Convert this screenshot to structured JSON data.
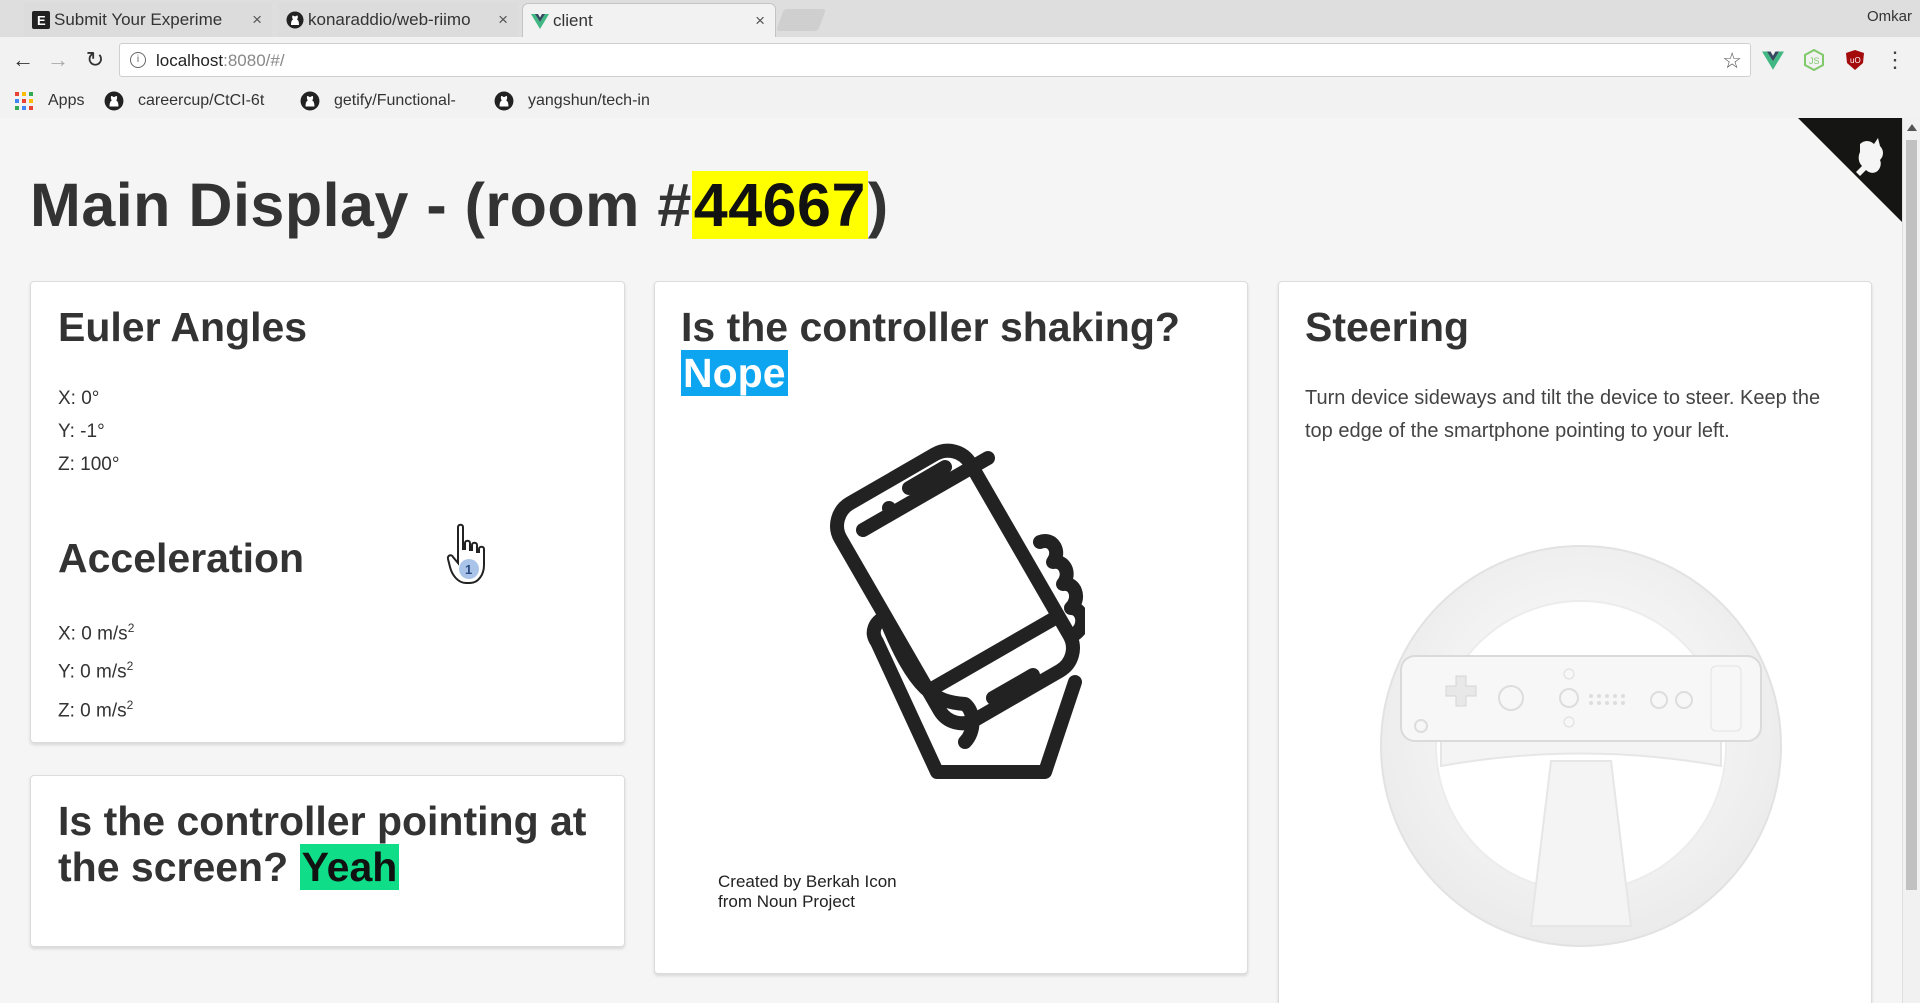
{
  "browser": {
    "tabs": [
      {
        "title": "Submit Your Experime",
        "favicon": "E",
        "active": false
      },
      {
        "title": "konaraddio/web-riimo",
        "favicon": "github-icon",
        "active": false
      },
      {
        "title": "client",
        "favicon": "vue-icon",
        "active": true
      }
    ],
    "profile": "Omkar",
    "url_host": "localhost",
    "url_path": ":8080/#/",
    "bookmarks": [
      {
        "label": "Apps",
        "icon": "apps-grid-icon"
      },
      {
        "label": "careercup/CtCI-6t",
        "icon": "github-icon"
      },
      {
        "label": "getify/Functional-",
        "icon": "github-icon"
      },
      {
        "label": "yangshun/tech-in",
        "icon": "github-icon"
      }
    ],
    "tab_close": "×"
  },
  "page": {
    "title_prefix": "Main Display - (room #",
    "room_number": "44667",
    "title_suffix": ")"
  },
  "euler": {
    "title": "Euler Angles",
    "x": "X: 0°",
    "y": "Y: -1°",
    "z": "Z: 100°"
  },
  "acceleration": {
    "title": "Acceleration",
    "x": "X: 0 m/s",
    "y": "Y: 0 m/s",
    "z": "Z: 0 m/s",
    "exponent": "2"
  },
  "pointing": {
    "question": "Is the controller pointing at the screen?",
    "answer": "Yeah"
  },
  "shaking": {
    "question": "Is the controller shaking?",
    "answer": "Nope",
    "credit_line1": "Created by Berkah Icon",
    "credit_line2": "from Noun Project"
  },
  "steering": {
    "title": "Steering",
    "description": "Turn device sideways and tilt the device to steer. Keep the top edge of the smartphone pointing to your left."
  },
  "colors": {
    "room_highlight": "#ffff00",
    "nope_highlight": "#0ea5f0",
    "yeah_highlight": "#10dd88"
  }
}
